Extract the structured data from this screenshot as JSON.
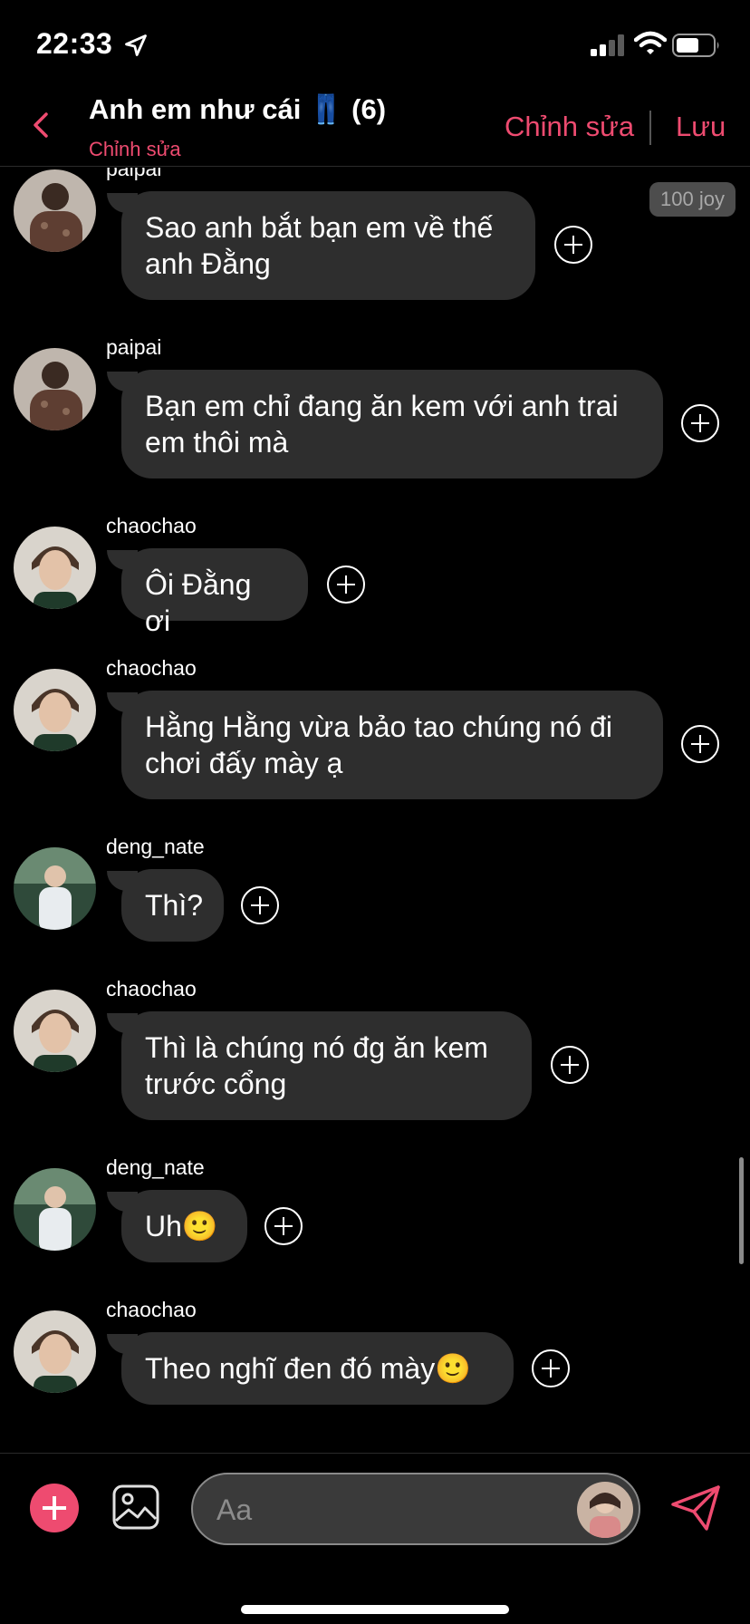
{
  "status_bar": {
    "time": "22:33"
  },
  "header": {
    "title": "Anh em như cái 👖 (6)",
    "subtitle": "Chỉnh sửa",
    "edit_label": "Chỉnh sửa",
    "save_label": "Lưu"
  },
  "joy_badge": "100 joy",
  "messages": [
    {
      "sender": "paipai",
      "text_lines": [
        "Sao anh bắt bạn em về thế",
        "anh Đằng"
      ]
    },
    {
      "sender": "paipai",
      "text_lines": [
        "Bạn em chỉ đang ăn kem với anh trai",
        "em thôi mà"
      ]
    },
    {
      "sender": "chaochao",
      "text_lines": [
        "Ôi Đằng ơi"
      ]
    },
    {
      "sender": "chaochao",
      "text_lines": [
        "Hằng Hằng vừa bảo tao chúng nó đi",
        "chơi đấy mày ạ"
      ]
    },
    {
      "sender": "deng_nate",
      "text_lines": [
        "Thì?"
      ]
    },
    {
      "sender": "chaochao",
      "text_lines": [
        "Thì là chúng nó đg ăn kem",
        "trước cổng"
      ]
    },
    {
      "sender": "deng_nate",
      "text_lines": [
        "Uh🙂"
      ]
    },
    {
      "sender": "chaochao",
      "text_lines": [
        "Theo nghĩ đen đó mày🙂"
      ]
    }
  ],
  "composer": {
    "placeholder": "Aa"
  },
  "colors": {
    "accent": "#ee4b70",
    "bubble": "#2e2e2e",
    "background": "#000000"
  }
}
